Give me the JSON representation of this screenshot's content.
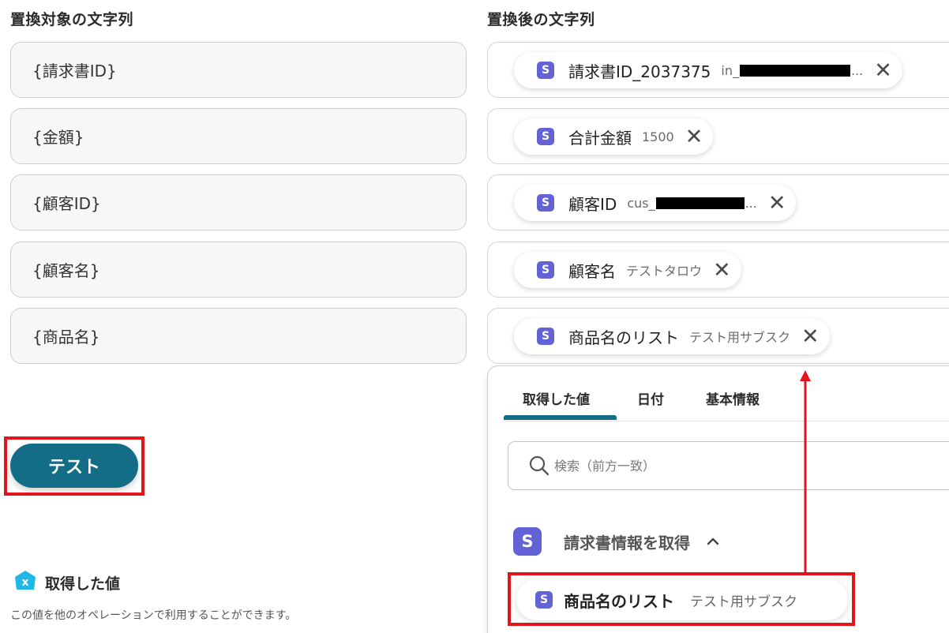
{
  "left": {
    "title": "置換対象の文字列",
    "fields": [
      "{請求書ID}",
      "{金額}",
      "{顧客ID}",
      "{顧客名}",
      "{商品名}"
    ]
  },
  "right": {
    "title": "置換後の文字列",
    "chips": [
      {
        "icon": "S",
        "label": "請求書ID_2037375",
        "value": "in_",
        "trailing": "..."
      },
      {
        "icon": "S",
        "label": "合計金額",
        "value": "1500",
        "trailing": ""
      },
      {
        "icon": "S",
        "label": "顧客ID",
        "value": "cus_",
        "trailing": "..."
      },
      {
        "icon": "S",
        "label": "顧客名",
        "value": "テストタロウ",
        "trailing": ""
      },
      {
        "icon": "S",
        "label": "商品名のリスト",
        "value": "テスト用サブスク",
        "trailing": ""
      }
    ]
  },
  "test_button": {
    "label": "テスト"
  },
  "got_values": {
    "badge": "x",
    "title": "取得した値",
    "description": "この値を他のオペレーションで利用することができます。"
  },
  "picker": {
    "tabs": [
      {
        "label": "取得した値",
        "active": true
      },
      {
        "label": "日付",
        "active": false
      },
      {
        "label": "基本情報",
        "active": false
      }
    ],
    "search": {
      "placeholder": "検索（前方一致）"
    },
    "group": {
      "icon": "S",
      "title": "請求書情報を取得",
      "expanded": true
    },
    "item": {
      "icon": "S",
      "label": "商品名のリスト",
      "value": "テスト用サブスク"
    }
  },
  "colors": {
    "accent": "#136d87",
    "stripe_purple": "#6363d6",
    "highlight_red": "#e3141c"
  }
}
